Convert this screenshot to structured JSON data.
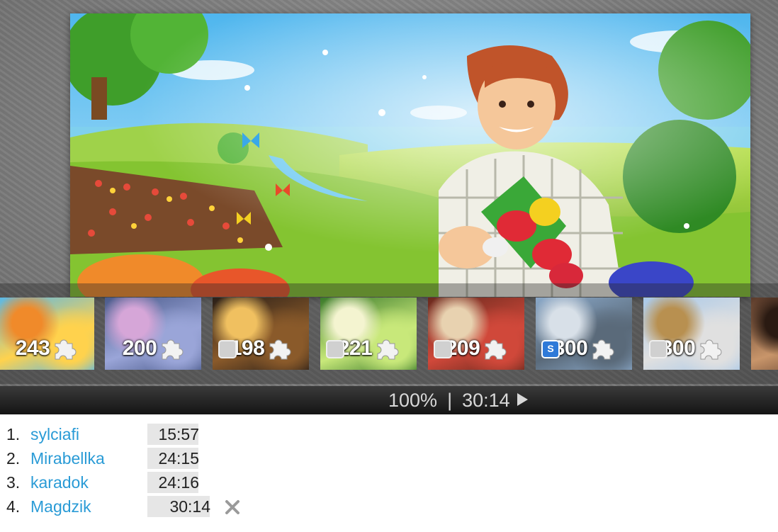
{
  "hero": {
    "alt": "farm scene"
  },
  "thumbnails": [
    {
      "count": "243",
      "palette": [
        "#59b8e8",
        "#ffd24d",
        "#f08a2a"
      ],
      "has_badge": false
    },
    {
      "count": "200",
      "palette": [
        "#4a5a8a",
        "#9aa5d8",
        "#d6a6d8"
      ],
      "has_badge": false
    },
    {
      "count": "198",
      "palette": [
        "#2a1f18",
        "#8a5a2a",
        "#f0c060"
      ],
      "has_badge": true,
      "badge_icon": "user-avatar-icon"
    },
    {
      "count": "221",
      "palette": [
        "#3a7a2a",
        "#c8e87a",
        "#f4f4d0"
      ],
      "has_badge": true,
      "badge_icon": "user-avatar-icon"
    },
    {
      "count": "209",
      "palette": [
        "#6a2a1e",
        "#d0483a",
        "#e8d2b0"
      ],
      "has_badge": true,
      "badge_icon": "user-avatar-icon"
    },
    {
      "count": "300",
      "palette": [
        "#8aa8c8",
        "#5a6a7a",
        "#d8e0e8"
      ],
      "has_badge": true,
      "badge_icon": "s-logo-icon"
    },
    {
      "count": "300",
      "palette": [
        "#a8c8e8",
        "#e0e0e0",
        "#b89050"
      ],
      "has_badge": true,
      "badge_icon": "user-avatar-icon"
    },
    {
      "count": "",
      "palette": [
        "#5a3a2a",
        "#c8956a",
        "#2a1a12"
      ],
      "has_badge": false
    }
  ],
  "status": {
    "zoom": "100%",
    "separator": "|",
    "time": "30:14"
  },
  "leaderboard": [
    {
      "rank": "1.",
      "name": "sylciafi",
      "time": "15:57"
    },
    {
      "rank": "2.",
      "name": "Mirabellka",
      "time": "24:15"
    },
    {
      "rank": "3.",
      "name": "karadok",
      "time": "24:16"
    },
    {
      "rank": "4.",
      "name": "Magdzik",
      "time": "30:14"
    }
  ],
  "colors": {
    "link": "#2a9bd6",
    "statusbar": "#1e1e1e",
    "time_bg": "#e6e6e6"
  }
}
